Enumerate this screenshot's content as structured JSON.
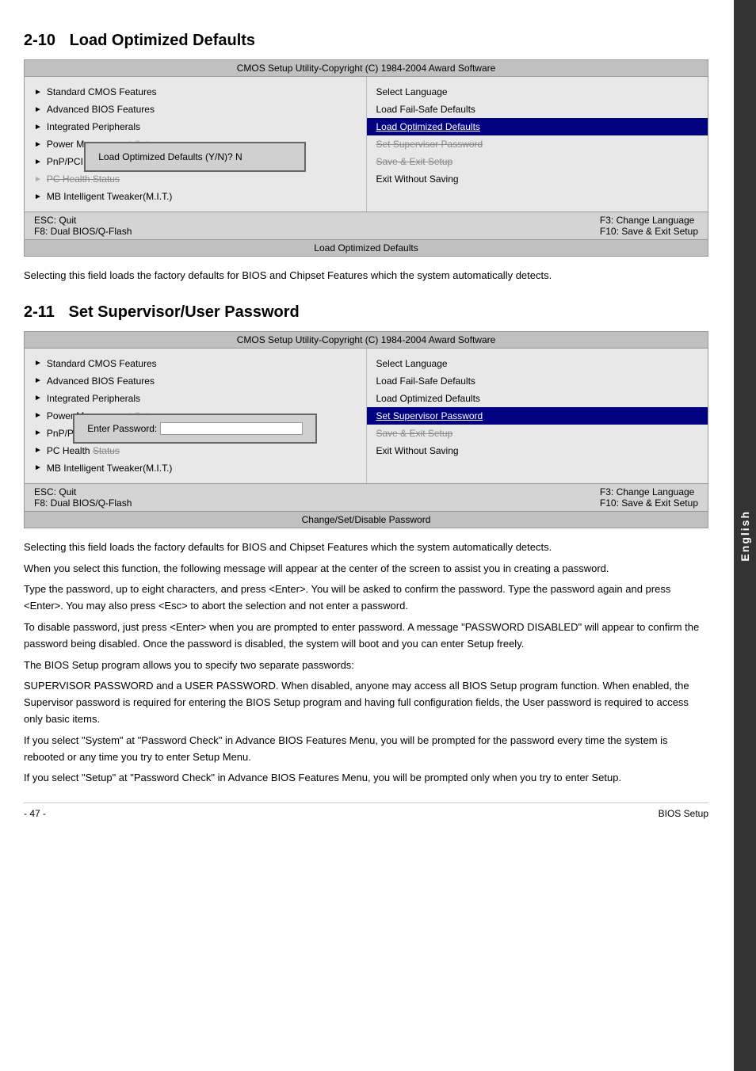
{
  "side_tab": "English",
  "section1": {
    "number": "2-10",
    "title": "Load Optimized Defaults",
    "bios_title": "CMOS Setup Utility-Copyright (C) 1984-2004 Award Software",
    "left_items": [
      {
        "arrow": true,
        "label": "Standard CMOS Features"
      },
      {
        "arrow": true,
        "label": "Advanced BIOS Features"
      },
      {
        "arrow": true,
        "label": "Integrated Peripherals"
      },
      {
        "arrow": true,
        "label": "Power Man..."
      },
      {
        "arrow": true,
        "label": "PnP/PCI C"
      },
      {
        "arrow": true,
        "label": "PC Health Status",
        "striked": true
      },
      {
        "arrow": true,
        "label": "MB Intelligent Tweaker(M.I.T.)"
      }
    ],
    "right_items": [
      {
        "label": "Select Language"
      },
      {
        "label": "Load Fail-Safe Defaults"
      },
      {
        "label": "Load Optimized Defaults",
        "highlighted": true
      },
      {
        "label": "Set Supervisor Password",
        "partial": true
      },
      {
        "label": "Save & Exit Setup",
        "striked": true
      },
      {
        "label": "Exit Without Saving"
      }
    ],
    "popup_text": "Load Optimized Defaults (Y/N)? N",
    "footer_left1": "ESC: Quit",
    "footer_left2": "F8: Dual BIOS/Q-Flash",
    "footer_right1": "F3: Change Language",
    "footer_right2": "F10: Save & Exit Setup",
    "status_bar": "Load Optimized Defaults",
    "description": "Selecting this field loads the factory defaults for BIOS and Chipset Features which the system automatically detects."
  },
  "section2": {
    "number": "2-11",
    "title": "Set Supervisor/User Password",
    "bios_title": "CMOS Setup Utility-Copyright (C) 1984-2004 Award Software",
    "left_items": [
      {
        "arrow": true,
        "label": "Standard CMOS Features"
      },
      {
        "arrow": true,
        "label": "Advanced BIOS Features"
      },
      {
        "arrow": true,
        "label": "Integrated Peripherals"
      },
      {
        "arrow": true,
        "label": "Power Management Setup"
      },
      {
        "arrow": true,
        "label": "PnP/PCI C"
      },
      {
        "arrow": true,
        "label": "PC Health Status"
      },
      {
        "arrow": true,
        "label": "MB Intelligent Tweaker(M.I.T.)"
      }
    ],
    "right_items": [
      {
        "label": "Select Language"
      },
      {
        "label": "Load Fail-Safe Defaults"
      },
      {
        "label": "Load Optimized Defaults"
      },
      {
        "label": "Set Supervisor Password",
        "highlighted": true
      },
      {
        "label": "Save & Exit Setup",
        "striked": true
      },
      {
        "label": "Exit Without Saving"
      }
    ],
    "popup_label": "Enter Password:",
    "footer_left1": "ESC: Quit",
    "footer_left2": "F8: Dual BIOS/Q-Flash",
    "footer_right1": "F3: Change Language",
    "footer_right2": "F10: Save & Exit Setup",
    "status_bar": "Change/Set/Disable Password",
    "paragraphs": [
      "Selecting this field loads the factory defaults for BIOS and Chipset Features which the system automatically detects.",
      "When you select this function, the following message will appear at the center of the screen to assist you in creating a password.",
      "Type the password, up to eight characters, and press <Enter>. You will be asked to confirm the password. Type the password again and press <Enter>. You may also press <Esc> to abort the selection and not enter a password.",
      "To disable password, just press <Enter> when you are prompted to enter password. A message \"PASSWORD DISABLED\" will appear to confirm the password being disabled. Once the password is disabled, the system will boot and you can enter Setup freely.",
      "The BIOS Setup program allows you to specify two separate passwords:",
      "SUPERVISOR PASSWORD and a USER PASSWORD. When disabled, anyone may access all BIOS Setup program function. When enabled, the Supervisor password is required for entering the BIOS Setup program and having full configuration fields, the User password is required to access only basic items.",
      "If you select \"System\" at \"Password Check\" in Advance BIOS Features Menu, you will be prompted for the password every time the system is rebooted or any time you try to enter Setup Menu.",
      "If you select \"Setup\" at \"Password Check\" in Advance BIOS Features Menu, you will be prompted only when you try to enter Setup."
    ]
  },
  "page_footer": {
    "left": "- 47 -",
    "right": "BIOS Setup"
  }
}
